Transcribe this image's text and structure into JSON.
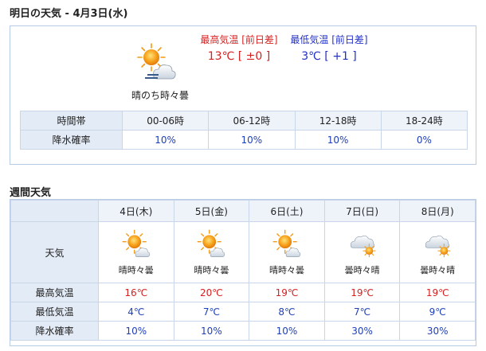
{
  "tomorrow": {
    "heading": "明日の天気 - 4月3日(水)",
    "weather_icon": "sun-cloud-icon",
    "weather_text": "晴のち時々曇",
    "high_label": "最高気温 [前日差]",
    "high_value": "13℃ [ ±0 ]",
    "low_label": "最低気温 [前日差]",
    "low_value": "3℃ [ +1 ]",
    "table": {
      "row1_label": "時間帯",
      "row2_label": "降水確率",
      "periods": [
        "00-06時",
        "06-12時",
        "12-18時",
        "18-24時"
      ],
      "precip": [
        "10%",
        "10%",
        "10%",
        "0%"
      ]
    }
  },
  "weekly": {
    "heading": "週間天気",
    "weather_label": "天気",
    "high_label": "最高気温",
    "low_label": "最低気温",
    "precip_label": "降水確率",
    "days": [
      {
        "date": "4日(木)",
        "icon": "sun-cloud-icon",
        "weather": "晴時々曇",
        "high": "16℃",
        "low": "4℃",
        "precip": "10%"
      },
      {
        "date": "5日(金)",
        "icon": "sun-cloud-icon",
        "weather": "晴時々曇",
        "high": "20℃",
        "low": "7℃",
        "precip": "10%"
      },
      {
        "date": "6日(土)",
        "icon": "sun-cloud-icon",
        "weather": "晴時々曇",
        "high": "19℃",
        "low": "8℃",
        "precip": "10%"
      },
      {
        "date": "7日(日)",
        "icon": "cloud-sun-icon",
        "weather": "曇時々晴",
        "high": "19℃",
        "low": "7℃",
        "precip": "30%"
      },
      {
        "date": "8日(月)",
        "icon": "cloud-sun-icon",
        "weather": "曇時々晴",
        "high": "19℃",
        "low": "9℃",
        "precip": "30%"
      }
    ]
  },
  "colors": {
    "high": "#d62020",
    "low": "#1f3fb8",
    "border": "#b7cbe6",
    "header_bg": "#e3ebf6"
  }
}
